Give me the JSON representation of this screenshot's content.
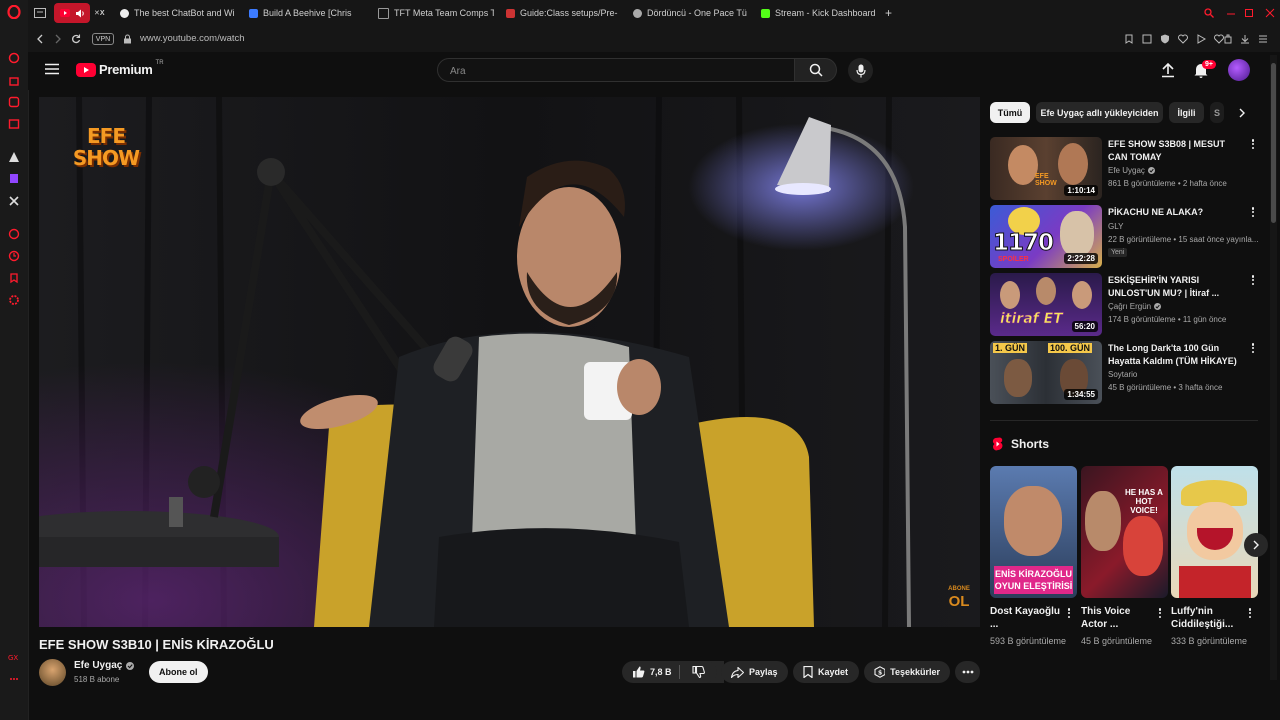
{
  "browser": {
    "tabs": [
      {
        "label": "",
        "icon": "youtube-playing-tab"
      },
      {
        "label": "",
        "icon": "tab-icon"
      },
      {
        "label": "The best ChatBot and Wi",
        "icon": "chatbot-favicon"
      },
      {
        "label": "Build A Beehive [Chris",
        "icon": "page-favicon"
      },
      {
        "label": "TFT Meta Team Comps T",
        "icon": "tft-favicon"
      },
      {
        "label": "Guide:Class setups/Pre-",
        "icon": "wiki-favicon"
      },
      {
        "label": "Dördüncü - One Pace Tü",
        "icon": "onepace-favicon"
      },
      {
        "label": "Stream - Kick Dashboard",
        "icon": "kick-favicon"
      }
    ],
    "new_tab": "+",
    "vpn_label": "VPN",
    "url": "www.youtube.com/watch"
  },
  "yt": {
    "logo_text": "Premium",
    "region": "TR",
    "search_placeholder": "Ara",
    "notification_count": "9+"
  },
  "video": {
    "channel_watermark": "EFE\nSHOW",
    "subscribe_watermark_top": "ABONE",
    "subscribe_watermark_bottom": "OL",
    "title": "EFE SHOW S3B10 | ENİS KİRAZOĞLU",
    "channel_name": "Efe Uygaç",
    "subscribers": "518 B abone",
    "subscribe_label": "Abone ol",
    "like_count": "7,8 B",
    "share_label": "Paylaş",
    "save_label": "Kaydet",
    "thanks_label": "Teşekkürler"
  },
  "sidebar": {
    "chips": [
      "Tümü",
      "Efe Uygaç adlı yükleyiciden",
      "İlgili",
      "S"
    ],
    "recommendations": [
      {
        "title": "EFE SHOW S3B08 | MESUT CAN TOMAY",
        "channel": "Efe Uygaç",
        "verified": true,
        "meta": "861 B görüntüleme • 2 hafta önce",
        "duration": "1:10:14",
        "badge": ""
      },
      {
        "title": "PİKACHU NE ALAKA?",
        "channel": "GLY",
        "verified": false,
        "meta": "22 B görüntüleme • 15 saat önce yayınla...",
        "duration": "2:22:28",
        "badge": "Yeni",
        "thumb_text": "1170",
        "thumb_sub": "SPOİLER"
      },
      {
        "title": "ESKİŞEHİR'İN YARISI UNLOST'UN MU? | İtiraf ...",
        "channel": "Çağrı Ergün",
        "verified": true,
        "meta": "174 B görüntüleme • 11 gün önce",
        "duration": "56:20",
        "badge": "",
        "thumb_text": "itiraf ET"
      },
      {
        "title": "The Long Dark'ta 100 Gün Hayatta Kaldım (TÜM HİKAYE)",
        "channel": "Soytario",
        "verified": false,
        "meta": "45 B görüntüleme • 3 hafta önce",
        "duration": "1:34:55",
        "badge": "",
        "thumb_text": "1. GÜN",
        "thumb_text2": "100. GÜN"
      }
    ],
    "shorts_heading": "Shorts",
    "shorts": [
      {
        "title": "Dost Kayaoğlu ...",
        "views": "593 B görüntüleme",
        "thumb_text": "ENİS KİRAZOĞLU OYUN ELEŞTİRİSİ"
      },
      {
        "title": "This Voice Actor ...",
        "views": "45 B görüntüleme",
        "thumb_text": "HE HAS A HOT VOICE!"
      },
      {
        "title": "Luffy'nin Ciddileştiği...",
        "views": "333 B görüntüleme",
        "thumb_text": ""
      }
    ]
  },
  "colors": {
    "accent": "#ff0033",
    "opera_red": "#ff1b2d",
    "kick_green": "#53fc18"
  }
}
